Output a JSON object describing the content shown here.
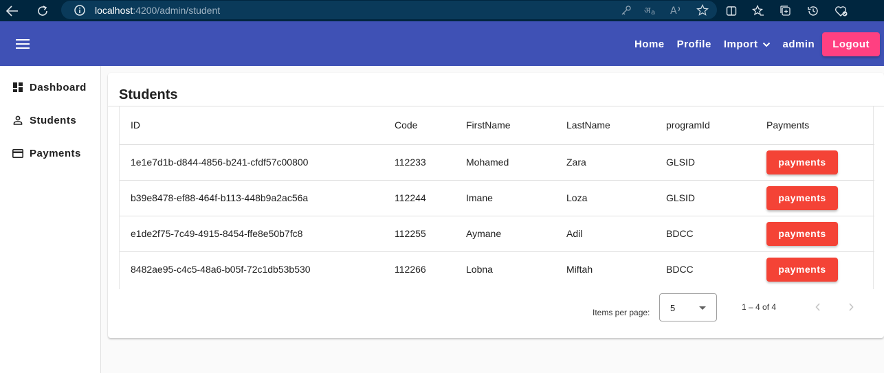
{
  "browser": {
    "url_host": "localhost",
    "url_path": ":4200/admin/student"
  },
  "toolbar": {
    "nav": [
      "Home",
      "Profile",
      "Import",
      "admin"
    ],
    "logout_label": "Logout"
  },
  "sidebar": {
    "items": [
      {
        "label": "Dashboard",
        "icon": "dashboard-icon"
      },
      {
        "label": "Students",
        "icon": "person-icon"
      },
      {
        "label": "Payments",
        "icon": "credit-card-icon"
      }
    ]
  },
  "main": {
    "title": "Students",
    "columns": [
      "ID",
      "Code",
      "FirstName",
      "LastName",
      "programId",
      "Payments"
    ],
    "rows": [
      {
        "id": "1e1e7d1b-d844-4856-b241-cfdf57c00800",
        "code": "112233",
        "first": "Mohamed",
        "last": "Zara",
        "program": "GLSID",
        "action": "payments"
      },
      {
        "id": "b39e8478-ef88-464f-b113-448b9a2ac56a",
        "code": "112244",
        "first": "Imane",
        "last": "Loza",
        "program": "GLSID",
        "action": "payments"
      },
      {
        "id": "e1de2f75-7c49-4915-8454-ffe8e50b7fc8",
        "code": "112255",
        "first": "Aymane",
        "last": "Adil",
        "program": "BDCC",
        "action": "payments"
      },
      {
        "id": "8482ae95-c4c5-48a6-b05f-72c1db53b530",
        "code": "112266",
        "first": "Lobna",
        "last": "Miftah",
        "program": "BDCC",
        "action": "payments"
      }
    ]
  },
  "paginator": {
    "items_per_page_label": "Items per page:",
    "page_size": "5",
    "range_label": "1 – 4 of 4"
  },
  "colors": {
    "primary": "#3f51b5",
    "accent": "#ff4081",
    "warn": "#f44336"
  }
}
